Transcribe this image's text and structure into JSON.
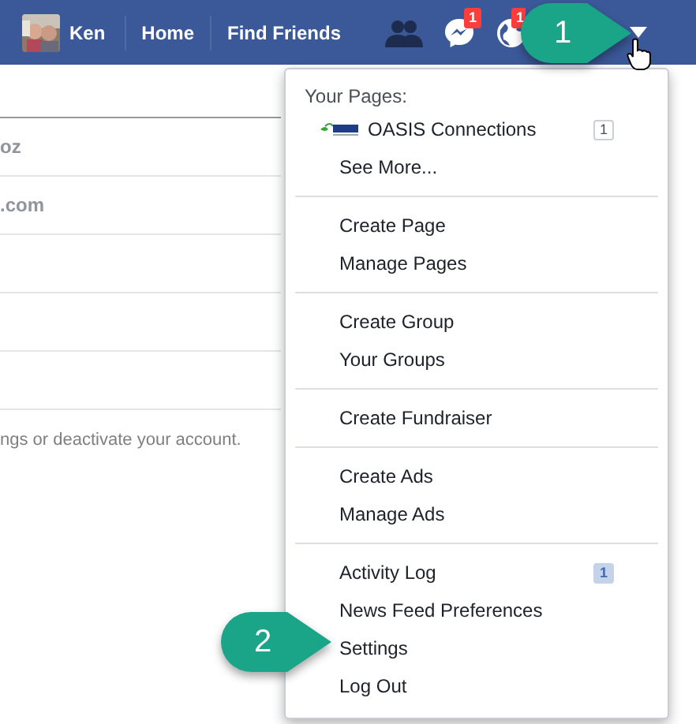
{
  "top_bar": {
    "user": "Ken",
    "links": [
      "Home",
      "Find Friends"
    ],
    "messages_badge": "1",
    "notifications_badge": "1"
  },
  "settings_rows": [
    {
      "value": "oz"
    },
    {
      "value": ".com"
    }
  ],
  "settings_note": "ngs or deactivate your account.",
  "menu": {
    "heading": "Your Pages:",
    "sections": [
      [
        {
          "kind": "page",
          "label": "OASIS Connections",
          "badge": {
            "text": "1",
            "kind": "outline"
          }
        },
        {
          "kind": "link",
          "label": "See More..."
        }
      ],
      [
        {
          "kind": "link",
          "label": "Create Page"
        },
        {
          "kind": "link",
          "label": "Manage Pages"
        }
      ],
      [
        {
          "kind": "link",
          "label": "Create Group"
        },
        {
          "kind": "link",
          "label": "Your Groups"
        }
      ],
      [
        {
          "kind": "link",
          "label": "Create Fundraiser"
        }
      ],
      [
        {
          "kind": "link",
          "label": "Create Ads"
        },
        {
          "kind": "link",
          "label": "Manage Ads"
        }
      ],
      [
        {
          "kind": "link",
          "label": "Activity Log",
          "badge": {
            "text": "1",
            "kind": "filled"
          }
        },
        {
          "kind": "link",
          "label": "News Feed Preferences"
        },
        {
          "kind": "link",
          "label": "Settings"
        },
        {
          "kind": "link",
          "label": "Log Out"
        }
      ]
    ]
  },
  "callouts": [
    {
      "label": "1"
    },
    {
      "label": "2"
    }
  ]
}
